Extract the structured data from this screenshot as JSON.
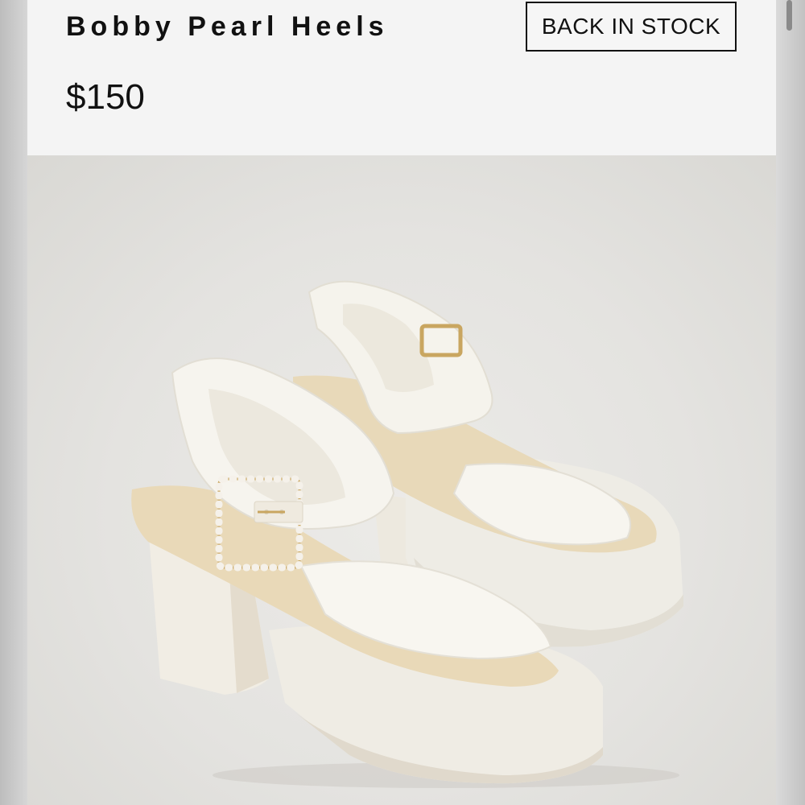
{
  "product": {
    "title": "Bobby Pearl Heels",
    "price": "$150",
    "badge": "BACK IN STOCK"
  },
  "image": {
    "subject": "white satin platform sandals with pearl buckle",
    "icon": "product-photo"
  },
  "colors": {
    "background": "#efefef",
    "text": "#111111",
    "shoe": "#f3f1ea",
    "footbed": "#e9dcc0",
    "pearl": "#f5f1ea",
    "buckle": "#c9a660"
  }
}
